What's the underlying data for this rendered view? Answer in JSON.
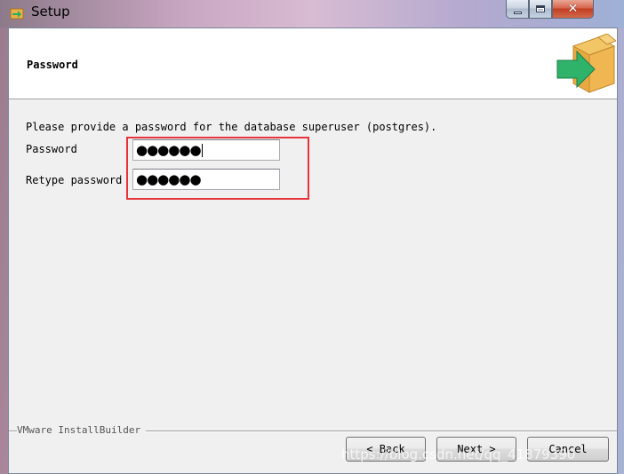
{
  "window": {
    "title": "Setup",
    "controls": {
      "minimize": "",
      "maximize": "",
      "close": "✕"
    }
  },
  "header": {
    "title": "Password",
    "icon": "package-arrow-icon"
  },
  "form": {
    "prompt": "Please provide a password for the database superuser (postgres).",
    "password_label": "Password",
    "password_value": "●●●●●●",
    "retype_label": "Retype password",
    "retype_value": "●●●●●●"
  },
  "footer": {
    "brand": "VMware InstallBuilder",
    "back_label": "< Back",
    "next_label": "Next >",
    "cancel_label": "Cancel"
  },
  "overlay": {
    "highlight_color": "#e8333b",
    "watermark": "https://blog.csdn.net/qq_41879390"
  }
}
